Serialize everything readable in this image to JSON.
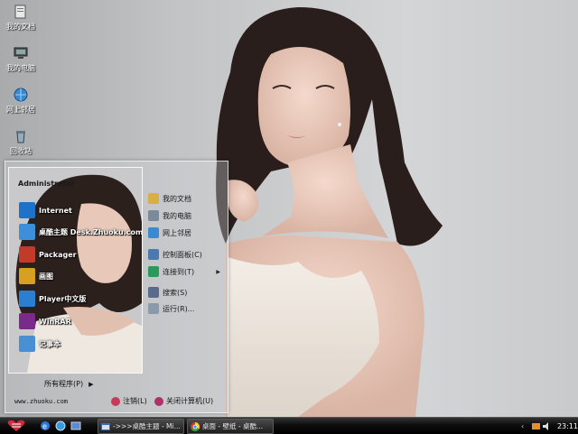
{
  "desktop": {
    "icons": [
      {
        "label": "我的文档",
        "icon": "my-documents-icon"
      },
      {
        "label": "我的电脑",
        "icon": "my-computer-icon"
      },
      {
        "label": "网上邻居",
        "icon": "network-places-icon"
      },
      {
        "label": "回收站",
        "icon": "recycle-bin-icon"
      }
    ]
  },
  "start_menu": {
    "user": "Administrator",
    "programs": [
      {
        "label": "Internet",
        "icon": "internet-explorer-icon",
        "color": "#1e72c8"
      },
      {
        "label": "桌酷主题 Desk.Zhuoku.com",
        "icon": "zhuoku-theme-icon",
        "color": "#3c8fd8"
      },
      {
        "label": "Packager",
        "icon": "packager-icon",
        "color": "#c23a2a"
      },
      {
        "label": "画图",
        "icon": "paint-icon",
        "color": "#d8a020"
      },
      {
        "label": "Player中文版",
        "icon": "media-player-icon",
        "color": "#2a7fd0"
      },
      {
        "label": "WinRAR",
        "icon": "winrar-icon",
        "color": "#7a2a8a"
      },
      {
        "label": "记事本",
        "icon": "notepad-icon",
        "color": "#4a90d0"
      }
    ],
    "all_programs": "所有程序(P)",
    "places": [
      {
        "label": "我的文档",
        "icon": "my-documents-icon",
        "color": "#d8b040",
        "submenu": false
      },
      {
        "label": "我的电脑",
        "icon": "my-computer-icon",
        "color": "#7a8a9a",
        "submenu": false
      },
      {
        "label": "网上邻居",
        "icon": "network-places-icon",
        "color": "#3a8ad0",
        "submenu": false
      },
      {
        "label": "控制面板(C)",
        "icon": "control-panel-icon",
        "color": "#4a7ab0",
        "submenu": false
      },
      {
        "label": "连接到(T)",
        "icon": "connect-to-icon",
        "color": "#2a9a5a",
        "submenu": true
      },
      {
        "label": "搜索(S)",
        "icon": "search-icon",
        "color": "#5a6a8a",
        "submenu": false
      },
      {
        "label": "运行(R)...",
        "icon": "run-icon",
        "color": "#8a9aaa",
        "submenu": false
      }
    ],
    "site": "www.zhuoku.com",
    "logoff": "注销(L)",
    "shutdown": "关闭计算机(U)",
    "colors": {
      "logoff": "#c83a5a",
      "shutdown": "#b0306a"
    }
  },
  "taskbar": {
    "tasks": [
      {
        "label": "->>>桌酷主题 - Mi...",
        "icon": "window-icon"
      },
      {
        "label": "桌面 - 壁纸 - 桌酷...",
        "icon": "chrome-icon"
      }
    ],
    "clock": "23:11"
  }
}
